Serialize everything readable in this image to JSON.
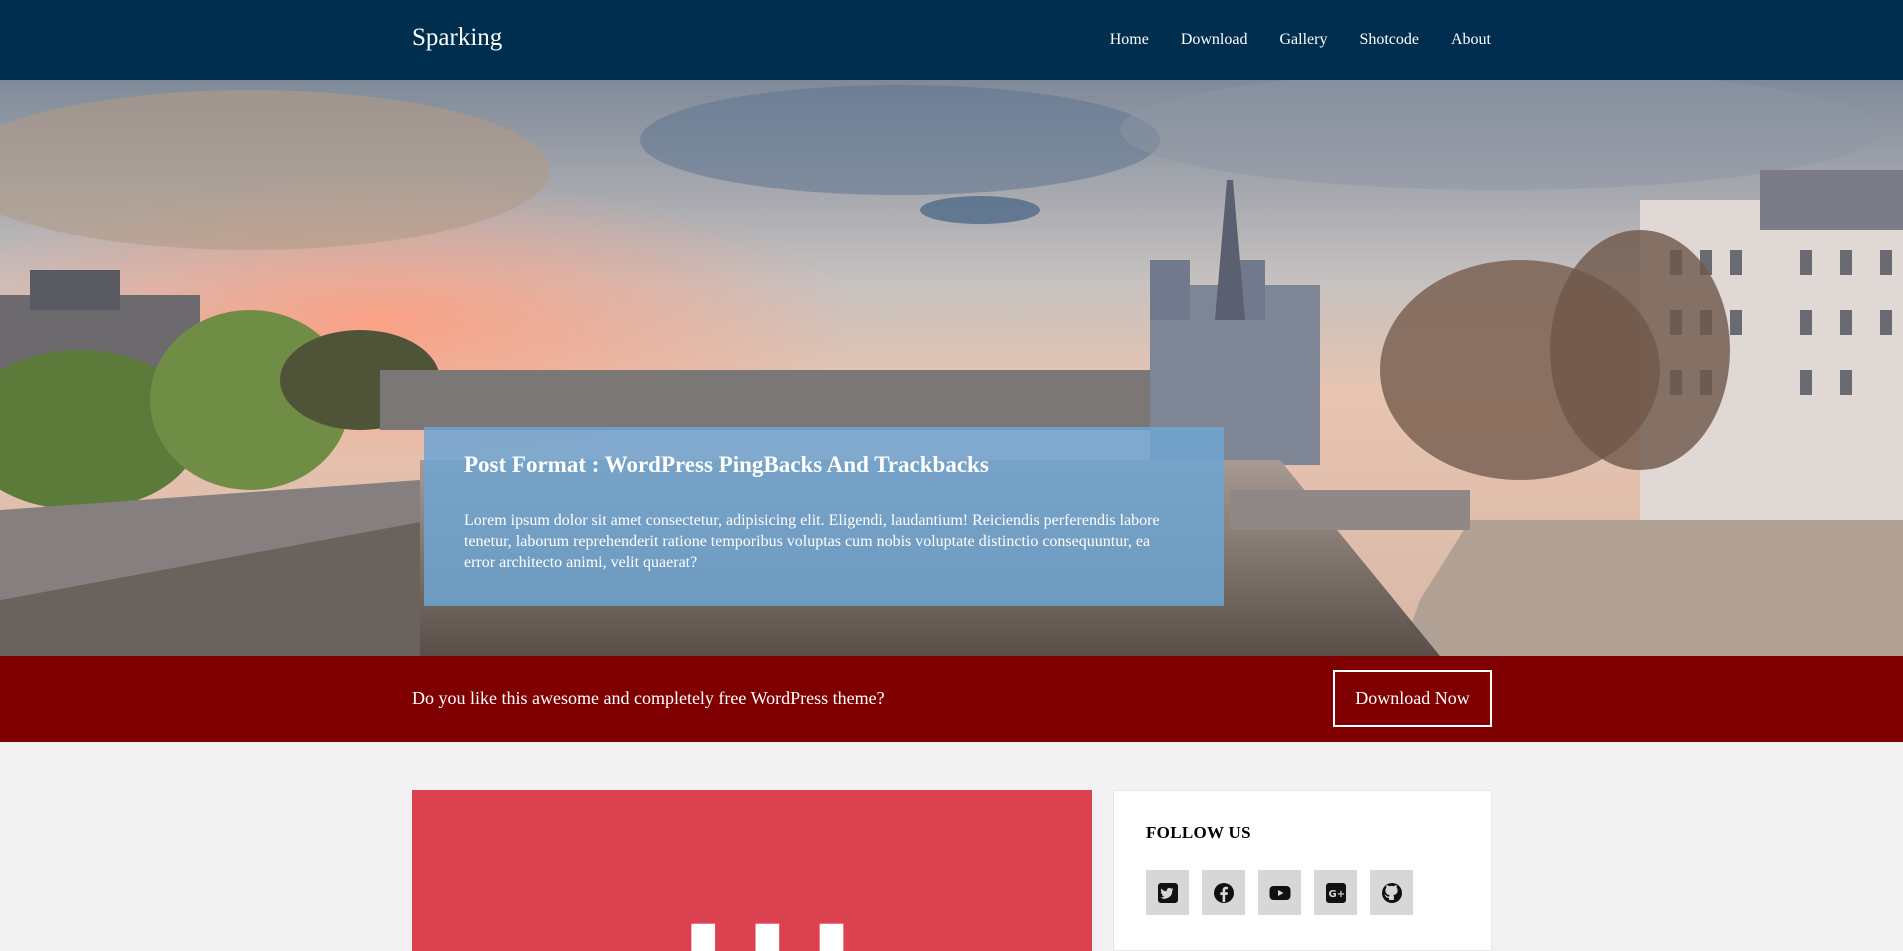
{
  "header": {
    "brand": "Sparking",
    "nav": [
      "Home",
      "Download",
      "Gallery",
      "Shotcode",
      "About"
    ]
  },
  "hero": {
    "title": "Post Format : WordPress PingBacks And Trackbacks",
    "excerpt": "Lorem ipsum dolor sit amet consectetur, adipisicing elit. Eligendi, laudantium! Reiciendis perferendis labore tenetur, laborum reprehenderit ratione temporibus voluptas cum nobis voluptate distinctio consequuntur, ea error architecto animi, velit quaerat?"
  },
  "cta": {
    "text": "Do you like this awesome and completely free WordPress theme?",
    "button": "Download Now"
  },
  "sidebar": {
    "follow_title": "FOLLOW US",
    "socials": [
      "twitter-icon",
      "facebook-icon",
      "youtube-icon",
      "google-plus-icon",
      "github-icon"
    ]
  },
  "colors": {
    "navbar": "#002e4e",
    "cta_bar": "#7e0000",
    "caption_bg": "#6ea5d2",
    "post_thumb": "#dc4150"
  }
}
